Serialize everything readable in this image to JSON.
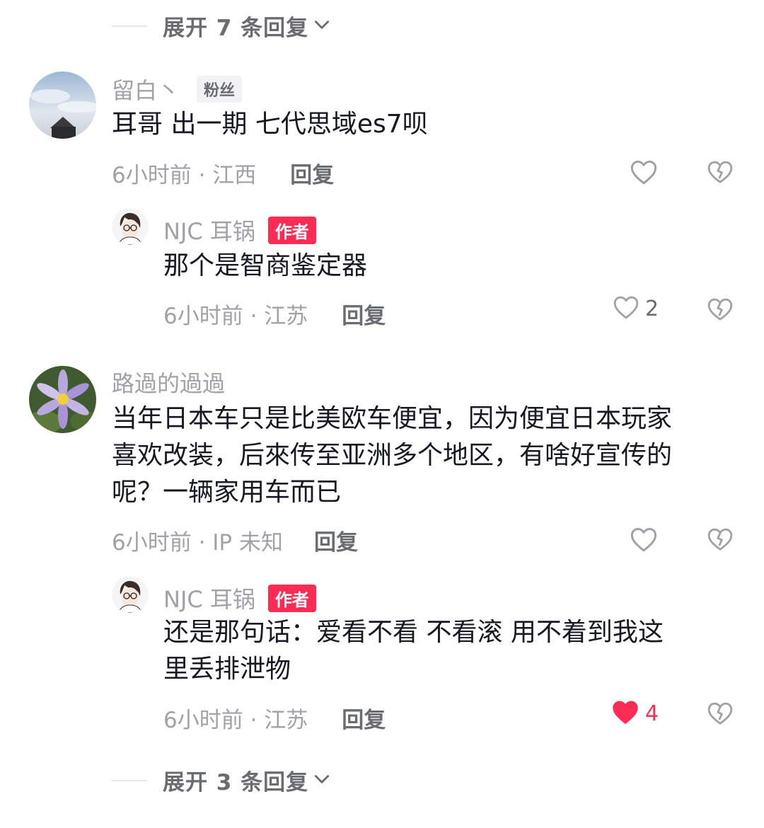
{
  "top_expand": {
    "label": "展开 7 条回复"
  },
  "bottom_expand": {
    "label": "展开 3 条回复"
  },
  "comments": [
    {
      "user": "留白丶",
      "badge": "粉丝",
      "text": "耳哥 出一期 七代思域es7呗",
      "meta": "6小时前 · 江西",
      "reply_label": "回复"
    },
    {
      "user": "路過的過過",
      "text_lines": [
        "当年日本车只是比美欧车便宜，因为便宜日本玩家",
        "喜欢改装，后來传至亚洲多个地区，有啥好宣传的",
        "呢？一辆家用车而已"
      ],
      "meta": "6小时前 · IP 未知",
      "reply_label": "回复"
    }
  ],
  "replies": [
    {
      "user": "NJC 耳锅",
      "badge": "作者",
      "text": "那个是智商鉴定器",
      "meta": "6小时前 · 江苏",
      "reply_label": "回复",
      "likes": "2",
      "liked": false
    },
    {
      "user": "NJC 耳锅",
      "badge": "作者",
      "text_lines": [
        "还是那句话：爱看不看 不看滚 用不着到我这",
        "里丢排泄物"
      ],
      "meta": "6小时前 · 江苏",
      "reply_label": "回复",
      "likes": "4",
      "liked": true
    }
  ],
  "colors": {
    "accent": "#fe2c55",
    "muted": "#a1a2a8",
    "text": "#161823"
  },
  "icons": [
    "heart-icon",
    "dislike-broken-heart-icon",
    "chevron-down-icon"
  ]
}
